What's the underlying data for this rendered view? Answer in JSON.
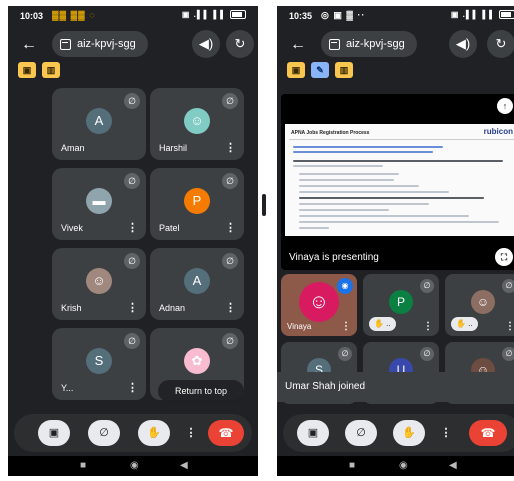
{
  "left": {
    "status": {
      "time": "10:03",
      "icons": "▓▓ ▓▓ ◌",
      "right": "▣ .▌▌ ▌▌"
    },
    "meeting_code": "aiz-kpvj-sgg",
    "participants": [
      {
        "name": "Aman",
        "initial": "A",
        "avatar_color": "#546e7a"
      },
      {
        "name": "Harshil",
        "initial": "",
        "avatar_color": "#80cbc4"
      },
      {
        "name": "Vivek",
        "initial": "",
        "avatar_color": "#90a4ae"
      },
      {
        "name": "Patel",
        "initial": "P",
        "avatar_color": "#f57c00"
      },
      {
        "name": "Krish",
        "initial": "",
        "avatar_color": "#a1887f"
      },
      {
        "name": "Adnan",
        "initial": "A",
        "avatar_color": "#546e7a"
      },
      {
        "name": "Y...",
        "initial": "S",
        "avatar_color": "#546e7a"
      },
      {
        "name": "",
        "initial": "",
        "avatar_color": "#f8bbd0"
      }
    ],
    "return_to_top": "Return to top"
  },
  "right": {
    "status": {
      "time": "10:35",
      "icons": "◎ ▣ ▓ ··",
      "right": "▣ .▌▌ ▌▌"
    },
    "meeting_code": "aiz-kpvj-sgg",
    "presentation": {
      "doc_title": "APNA Jobs Registration Process",
      "logo": "rubicon",
      "presenting_label": "Vinaya is presenting"
    },
    "tiles": [
      {
        "name": "Vinaya",
        "initial": "",
        "avatar_color": "#d81b60"
      },
      {
        "name": "",
        "initial": "P",
        "avatar_color": "#0b8043"
      },
      {
        "name": "",
        "initial": "",
        "avatar_color": "#8d6e63"
      },
      {
        "name": "",
        "initial": "S",
        "avatar_color": "#546e7a"
      },
      {
        "name": "",
        "initial": "U",
        "avatar_color": "#3949ab"
      },
      {
        "name": "",
        "initial": "",
        "avatar_color": "#6d4c41"
      }
    ],
    "hand_badge": "✋ ..",
    "toast": "Umar Shah joined"
  },
  "icons": {
    "back": "←",
    "speaker": "◀)",
    "switch_camera": "↻",
    "mic_off": "∅",
    "camera_off": "▣",
    "hand": "✋",
    "more": "⋮",
    "end_call": "☎",
    "nav_square": "■",
    "nav_circle": "◉",
    "nav_back": "◀",
    "pin": "↑",
    "fullscreen": "⛶"
  }
}
